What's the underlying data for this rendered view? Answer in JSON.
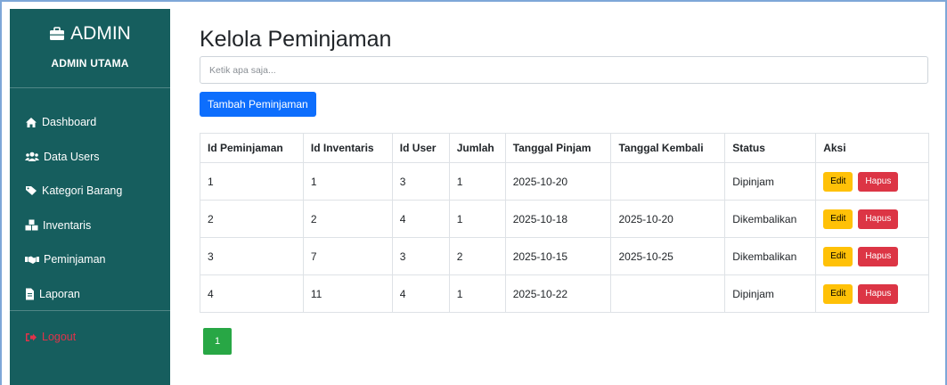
{
  "sidebar": {
    "brand": "ADMIN",
    "subtitle": "ADMIN UTAMA",
    "items": [
      {
        "label": "Dashboard",
        "icon": "home-icon"
      },
      {
        "label": "Data Users",
        "icon": "users-icon"
      },
      {
        "label": "Kategori Barang",
        "icon": "tag-icon"
      },
      {
        "label": "Inventaris",
        "icon": "boxes-icon"
      },
      {
        "label": "Peminjaman",
        "icon": "handshake-icon"
      },
      {
        "label": "Laporan",
        "icon": "file-icon"
      }
    ],
    "logout": "Logout"
  },
  "main": {
    "title": "Kelola Peminjaman",
    "search_placeholder": "Ketik apa saja...",
    "add_button": "Tambah Peminjaman"
  },
  "table": {
    "headers": [
      "Id Peminjaman",
      "Id Inventaris",
      "Id User",
      "Jumlah",
      "Tanggal Pinjam",
      "Tanggal Kembali",
      "Status",
      "Aksi"
    ],
    "rows": [
      [
        "1",
        "1",
        "3",
        "1",
        "2025-10-20",
        "",
        "Dipinjam"
      ],
      [
        "2",
        "2",
        "4",
        "1",
        "2025-10-18",
        "2025-10-20",
        "Dikembalikan"
      ],
      [
        "3",
        "7",
        "3",
        "2",
        "2025-10-15",
        "2025-10-25",
        "Dikembalikan"
      ],
      [
        "4",
        "11",
        "4",
        "1",
        "2025-10-22",
        "",
        "Dipinjam"
      ]
    ],
    "edit_label": "Edit",
    "delete_label": "Hapus"
  },
  "pagination": {
    "current": "1"
  },
  "colors": {
    "sidebar": "#165e5e",
    "primary": "#0d6efd",
    "warning": "#ffc107",
    "danger": "#dc3545",
    "success": "#28a745"
  }
}
